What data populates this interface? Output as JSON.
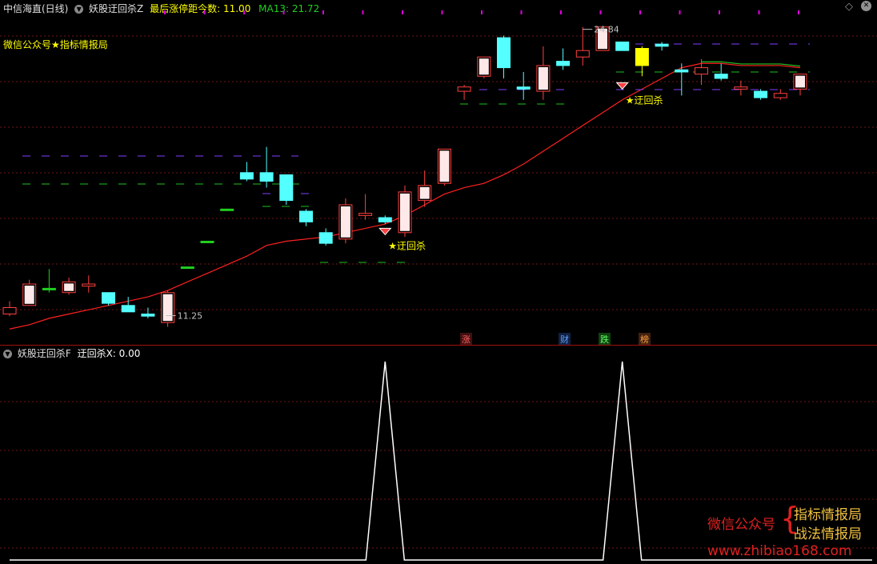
{
  "header": {
    "prefix": "中信海直(日线)",
    "indicator": "妖股迂回杀Z",
    "stat_label": "最后涨停距今数:",
    "stat_value": "11.00",
    "ma_text": "MA13: 21.72"
  },
  "subpanel": {
    "indicator": "妖股迂回杀F",
    "value_text": "迂回杀X: 0.00"
  },
  "overlay": {
    "promo": "微信公众号★指标情报局",
    "signal_label": "★迂回杀",
    "high_label": "24.84",
    "low_label": "11.25"
  },
  "badges": [
    "涨",
    "财",
    "跌",
    "榜"
  ],
  "watermark": {
    "left": "微信公众号",
    "brace": "{",
    "right_top": "指标情报局",
    "right_bottom": "战法情报局",
    "url": "www.zhibiao168.com"
  },
  "colors": {
    "up": "#ff4040",
    "down": "#54ffff",
    "yellow": "#ffff00",
    "ma": "#ff2020",
    "ma_tail": "#20c020",
    "grid": "#6a1a1a",
    "line": "#ffffff"
  },
  "chart_data": [
    {
      "type": "candlestick",
      "title": "妖股迂回杀Z",
      "x": [
        1,
        2,
        3,
        4,
        5,
        6,
        7,
        8,
        9,
        10,
        11,
        12,
        13,
        14,
        15,
        16,
        17,
        18,
        19,
        20,
        21,
        22,
        23,
        24,
        25,
        26,
        27,
        28,
        29,
        30,
        31,
        32,
        33,
        34,
        35,
        36,
        37,
        38,
        39,
        40,
        41
      ],
      "ohlc": [
        [
          11.4,
          12.0,
          11.3,
          11.7,
          "up"
        ],
        [
          11.8,
          13.0,
          11.8,
          12.8,
          "up"
        ],
        [
          12.6,
          13.5,
          12.4,
          12.6,
          "flat"
        ],
        [
          12.4,
          13.1,
          12.3,
          12.9,
          "up"
        ],
        [
          12.7,
          13.2,
          12.4,
          12.8,
          "up"
        ],
        [
          12.4,
          12.4,
          11.8,
          11.9,
          "down"
        ],
        [
          11.8,
          12.2,
          11.5,
          11.5,
          "down"
        ],
        [
          11.3,
          11.7,
          11.2,
          11.4,
          "down"
        ],
        [
          11.0,
          12.5,
          10.8,
          12.4,
          "up"
        ],
        [
          13.6,
          13.6,
          13.6,
          13.6,
          "flat"
        ],
        [
          14.8,
          14.8,
          14.8,
          14.8,
          "flat"
        ],
        [
          16.3,
          16.3,
          16.3,
          16.3,
          "flat"
        ],
        [
          18.0,
          18.5,
          17.6,
          17.7,
          "down"
        ],
        [
          17.6,
          19.2,
          17.3,
          18.0,
          "down"
        ],
        [
          17.9,
          17.9,
          16.5,
          16.7,
          "down"
        ],
        [
          16.2,
          16.3,
          15.5,
          15.7,
          "down"
        ],
        [
          15.2,
          15.4,
          14.6,
          14.7,
          "down"
        ],
        [
          14.9,
          16.8,
          14.7,
          16.5,
          "up"
        ],
        [
          16.0,
          17.0,
          15.8,
          16.1,
          "up"
        ],
        [
          15.9,
          16.0,
          15.6,
          15.7,
          "down"
        ],
        [
          15.2,
          17.4,
          15.0,
          17.1,
          "up"
        ],
        [
          16.7,
          18.1,
          16.4,
          17.4,
          "up"
        ],
        [
          17.5,
          19.1,
          17.4,
          19.1,
          "up"
        ],
        [
          22.0,
          22.1,
          21.4,
          21.8,
          "up"
        ],
        [
          22.5,
          23.4,
          22.4,
          23.4,
          "up"
        ],
        [
          22.9,
          24.4,
          22.4,
          24.3,
          "down"
        ],
        [
          21.9,
          22.7,
          21.4,
          22.0,
          "down"
        ],
        [
          21.8,
          23.9,
          21.4,
          23.0,
          "up"
        ],
        [
          23.0,
          23.8,
          22.8,
          23.2,
          "down"
        ],
        [
          23.4,
          24.8,
          23.0,
          23.7,
          "up"
        ],
        [
          23.7,
          24.8,
          23.7,
          24.8,
          "up"
        ],
        [
          24.1,
          24.1,
          23.7,
          23.7,
          "down"
        ],
        [
          23.8,
          23.9,
          22.5,
          23.0,
          "yellow"
        ],
        [
          23.9,
          24.1,
          23.7,
          24.0,
          "down"
        ],
        [
          22.8,
          23.1,
          21.6,
          22.7,
          "down"
        ],
        [
          22.6,
          23.3,
          22.1,
          22.9,
          "up"
        ],
        [
          22.6,
          23.1,
          22.3,
          22.4,
          "down"
        ],
        [
          21.9,
          22.3,
          21.6,
          22.0,
          "up"
        ],
        [
          21.8,
          21.9,
          21.4,
          21.5,
          "down"
        ],
        [
          21.5,
          21.9,
          21.4,
          21.7,
          "up"
        ],
        [
          21.9,
          22.4,
          21.6,
          22.6,
          "up"
        ]
      ],
      "ma13": {
        "name": "MA13",
        "values": [
          10.7,
          10.9,
          11.2,
          11.4,
          11.6,
          11.8,
          12.0,
          12.2,
          12.5,
          12.9,
          13.3,
          13.7,
          14.1,
          14.6,
          14.8,
          14.9,
          15.0,
          15.2,
          15.4,
          15.6,
          16.0,
          16.5,
          17.0,
          17.3,
          17.5,
          17.9,
          18.4,
          19.0,
          19.6,
          20.2,
          20.8,
          21.4,
          21.9,
          22.4,
          22.9,
          23.1,
          23.1,
          23.0,
          23.0,
          23.0,
          22.9
        ]
      },
      "signals": [
        {
          "x": 20,
          "label": "★迂回杀",
          "price": 15.4
        },
        {
          "x": 32,
          "label": "★迂回杀",
          "price": 22.2
        }
      ],
      "high_marker": {
        "x": 30,
        "price": 24.84
      },
      "low_marker": {
        "x": 9,
        "price": 11.25
      }
    },
    {
      "type": "line",
      "title": "妖股迂回杀F",
      "series": [
        {
          "name": "迂回杀X",
          "values": [
            0,
            0,
            0,
            0,
            0,
            0,
            0,
            0,
            0,
            0,
            0,
            0,
            0,
            0,
            0,
            0,
            0,
            0,
            0,
            1,
            0,
            0,
            0,
            0,
            0,
            0,
            0,
            0,
            0,
            0,
            0,
            1,
            0,
            0,
            0,
            0,
            0,
            0,
            0,
            0,
            0
          ]
        }
      ],
      "ylim": [
        0,
        1
      ]
    }
  ]
}
